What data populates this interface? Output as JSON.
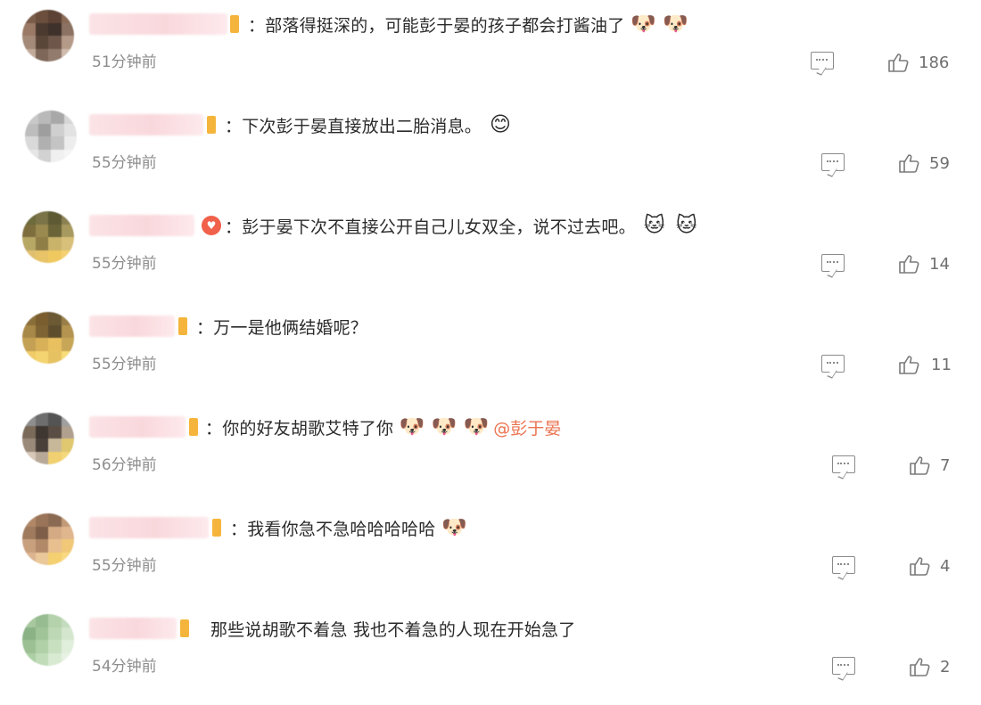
{
  "comments": [
    {
      "text": "：部落得挺深的，可能彭于晏的孩子都会打酱油了",
      "emoji": [
        "🐶",
        "🐶"
      ],
      "mention": "",
      "time": "51分钟前",
      "likes": "186",
      "avatar_colors": [
        "#7a5c4a",
        "#6b4e3c",
        "#5c4234",
        "#8a6a56",
        "#9a7a66",
        "#4b3a30",
        "#3e302a",
        "#8b7262",
        "#a48a78",
        "#5a4638",
        "#6e564a",
        "#b49a88",
        "#c2ab9a",
        "#7e6658",
        "#927a6c",
        "#d0bcae"
      ]
    },
    {
      "text": "：下次彭于晏直接放出二胎消息。",
      "emoji": [
        "😊"
      ],
      "mention": "",
      "time": "55分钟前",
      "likes": "59",
      "avatar_colors": [
        "#c8c8c8",
        "#b9b9b9",
        "#a8a8a8",
        "#d6d6d6",
        "#bdbdbd",
        "#9e9e9e",
        "#cfcfcf",
        "#e2e2e2",
        "#d9d9d9",
        "#b0b0b0",
        "#c4c4c4",
        "#ededed",
        "#e6e6e6",
        "#d2d2d2",
        "#f0f0f0",
        "#f5f5f5"
      ]
    },
    {
      "text": "：彭于晏下次不直接公开自己儿女双全，说不过去吧。",
      "emoji": [
        "🐱",
        "🐱"
      ],
      "mention": "",
      "time": "55分钟前",
      "likes": "14",
      "avatar_colors": [
        "#6d6a3c",
        "#7a7448",
        "#5e5a34",
        "#8a8052",
        "#7e6e3e",
        "#9a8a50",
        "#6a6438",
        "#a89a5e",
        "#b8a866",
        "#8f7e46",
        "#c9b26a",
        "#d8c07a",
        "#e0c070",
        "#e8c468",
        "#f0c860",
        "#f4d070"
      ]
    },
    {
      "text": "：万一是他俩结婚呢？",
      "emoji": [],
      "mention": "",
      "time": "55分钟前",
      "likes": "11",
      "avatar_colors": [
        "#8a6e3a",
        "#7a5e30",
        "#6c5a34",
        "#9a7e48",
        "#a88848",
        "#7e6434",
        "#5e4e2e",
        "#b49450",
        "#c4a054",
        "#d8b058",
        "#e8c060",
        "#c8a658",
        "#f0cc68",
        "#f4d470",
        "#e6c262",
        "#f8dc78"
      ]
    },
    {
      "text": "：你的好友胡歌艾特了你",
      "emoji": [
        "🐶",
        "🐶",
        "🐶"
      ],
      "mention": "@彭于晏",
      "time": "56分钟前",
      "likes": "7",
      "avatar_colors": [
        "#8e8e8e",
        "#6e6e6e",
        "#545454",
        "#a0a0a0",
        "#7a6a5a",
        "#3e3630",
        "#5a4e44",
        "#b0a090",
        "#9a8a7a",
        "#4a403a",
        "#c8b89a",
        "#e0c870",
        "#d8c8b8",
        "#b8a898",
        "#f0d070",
        "#f4d87a"
      ]
    },
    {
      "text": "：我看你急不急哈哈哈哈哈",
      "emoji": [
        "🐶"
      ],
      "mention": "",
      "time": "55分钟前",
      "likes": "4",
      "avatar_colors": [
        "#b08868",
        "#9a7458",
        "#8a6a52",
        "#c29a78",
        "#a07a5c",
        "#7e5e48",
        "#d4aa84",
        "#e0b68e",
        "#c8a07e",
        "#b28a6a",
        "#e8c090",
        "#f0c878",
        "#dcb490",
        "#eac89a",
        "#f4d070",
        "#f8d880"
      ]
    },
    {
      "text": "那些说胡歌不着急 我也不着急的人现在开始急了",
      "emoji": [],
      "mention": "",
      "time": "54分钟前",
      "likes": "2",
      "avatar_colors": [
        "#a8c8a0",
        "#98bc92",
        "#b4d2ac",
        "#c4dcbe",
        "#8ab284",
        "#a0c498",
        "#bcd8b4",
        "#d4e6ce",
        "#9cc094",
        "#b0d0a8",
        "#c8e0c0",
        "#e0eedc",
        "#acd0a4",
        "#c0dcb8",
        "#d8ead2",
        "#e8f2e4"
      ]
    }
  ]
}
